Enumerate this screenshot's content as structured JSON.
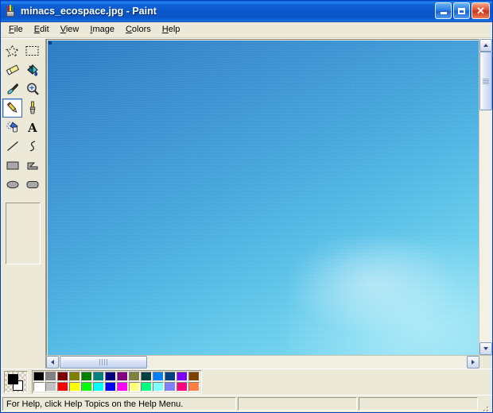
{
  "window": {
    "title": "minacs_ecospace.jpg - Paint",
    "icon": "paint-cup-icon",
    "caption_buttons": [
      {
        "name": "minimize",
        "label": "_"
      },
      {
        "name": "maximize",
        "label": "□"
      },
      {
        "name": "close",
        "label": "✕"
      }
    ]
  },
  "menu": {
    "items": [
      {
        "label": "File",
        "accel": "F"
      },
      {
        "label": "Edit",
        "accel": "E"
      },
      {
        "label": "View",
        "accel": "V"
      },
      {
        "label": "Image",
        "accel": "I"
      },
      {
        "label": "Colors",
        "accel": "C"
      },
      {
        "label": "Help",
        "accel": "H"
      }
    ]
  },
  "toolbox": {
    "tools": [
      {
        "name": "free-form-select",
        "label": "Free-Form Select",
        "selected": false
      },
      {
        "name": "rectangle-select",
        "label": "Select",
        "selected": false
      },
      {
        "name": "eraser",
        "label": "Eraser/Color Eraser",
        "selected": false
      },
      {
        "name": "fill",
        "label": "Fill With Color",
        "selected": false
      },
      {
        "name": "pick-color",
        "label": "Pick Color",
        "selected": false
      },
      {
        "name": "magnifier",
        "label": "Magnifier",
        "selected": false
      },
      {
        "name": "pencil",
        "label": "Pencil",
        "selected": true
      },
      {
        "name": "brush",
        "label": "Brush",
        "selected": false
      },
      {
        "name": "airbrush",
        "label": "Airbrush",
        "selected": false
      },
      {
        "name": "text",
        "label": "Text",
        "selected": false
      },
      {
        "name": "line",
        "label": "Line",
        "selected": false
      },
      {
        "name": "curve",
        "label": "Curve",
        "selected": false
      },
      {
        "name": "rectangle",
        "label": "Rectangle",
        "selected": false
      },
      {
        "name": "polygon",
        "label": "Polygon",
        "selected": false
      },
      {
        "name": "ellipse",
        "label": "Ellipse",
        "selected": false
      },
      {
        "name": "rounded-rectangle",
        "label": "Rounded Rectangle",
        "selected": false
      }
    ],
    "options_panel_empty": true
  },
  "canvas": {
    "image_name": "minacs_ecospace.jpg",
    "content_description": "photograph of blue sky with pale cloud haze at lower right",
    "colors": {
      "sky_top_left": "#2f7fc4",
      "sky_mid": "#4aa9de",
      "sky_bottom_right": "#86ddf2",
      "cloud_haze": "#d7faff"
    }
  },
  "scrollbars": {
    "vertical": {
      "up": "▲",
      "down": "▼",
      "thumb_grip": "≡"
    },
    "horizontal": {
      "left": "◀",
      "right": "▶",
      "thumb_grip": "|||"
    }
  },
  "palette": {
    "foreground": "#000000",
    "background": "#ffffff",
    "row1": [
      "#000000",
      "#808080",
      "#800000",
      "#808000",
      "#008000",
      "#008080",
      "#000080",
      "#800080",
      "#808040",
      "#004040",
      "#0080ff",
      "#004080",
      "#8000ff",
      "#804000"
    ],
    "row2": [
      "#ffffff",
      "#c0c0c0",
      "#ff0000",
      "#ffff00",
      "#00ff00",
      "#00ffff",
      "#0000ff",
      "#ff00ff",
      "#ffff80",
      "#00ff80",
      "#80ffff",
      "#8080ff",
      "#ff0080",
      "#ff8040"
    ]
  },
  "statusbar": {
    "message": "For Help, click Help Topics on the Help Menu.",
    "panel2": "",
    "panel3": ""
  }
}
